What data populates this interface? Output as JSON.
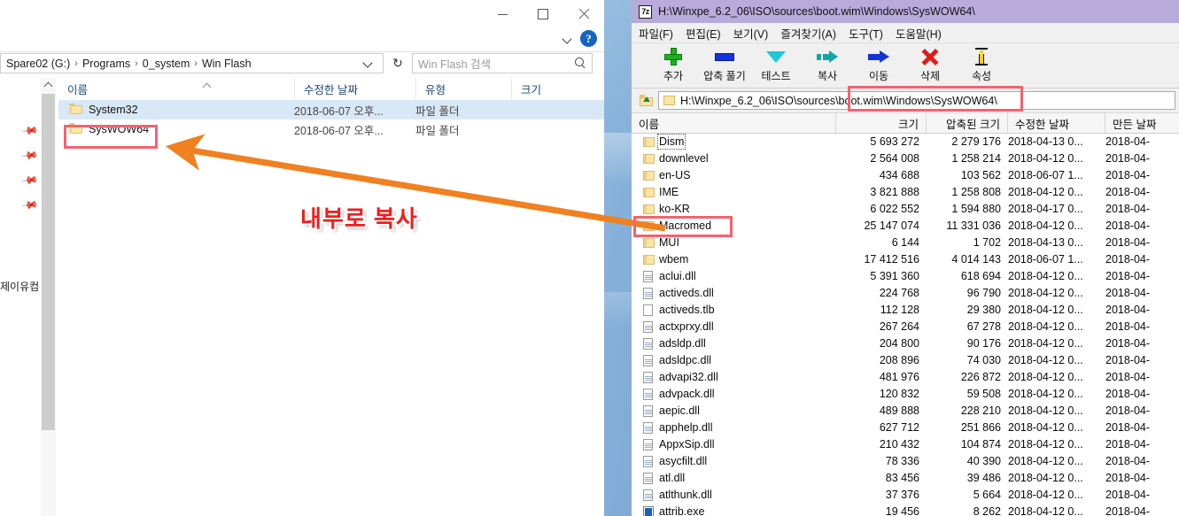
{
  "explorer": {
    "window_controls": {
      "minimize": "minimize-icon",
      "maximize": "maximize-icon",
      "close": "close-icon"
    },
    "ribbon": {
      "expand": "chevron-down-icon",
      "help": "?"
    },
    "breadcrumb": [
      "Spare02 (G:)",
      "Programs",
      "0_system",
      "Win Flash"
    ],
    "breadcrumb_separator": "›",
    "refresh_label": "↻",
    "search": {
      "placeholder": "Win Flash 검색",
      "icon": "search-icon"
    },
    "columns": [
      "이름",
      "수정한 날짜",
      "유형",
      "크기"
    ],
    "nav_label": "제이유컴",
    "rows": [
      {
        "name": "System32",
        "date": "2018-06-07 오후...",
        "type": "파일 폴더",
        "size": "",
        "selected": true
      },
      {
        "name": "SysWOW64",
        "date": "2018-06-07 오후...",
        "type": "파일 폴더",
        "size": "",
        "selected": false
      }
    ]
  },
  "sevenzip": {
    "title": "H:\\Winxpe_6.2_06\\ISO\\sources\\boot.wim\\Windows\\SysWOW64\\",
    "title_icon": "7z",
    "menu": [
      "파일(F)",
      "편집(E)",
      "보기(V)",
      "즐겨찾기(A)",
      "도구(T)",
      "도움말(H)"
    ],
    "toolbar": [
      {
        "label": "추가",
        "icon": "plus-icon"
      },
      {
        "label": "압축 풀기",
        "icon": "extract-icon"
      },
      {
        "label": "테스트",
        "icon": "test-chevron-icon"
      },
      {
        "label": "복사",
        "icon": "copy-arrow-icon"
      },
      {
        "label": "이동",
        "icon": "move-arrow-icon"
      },
      {
        "label": "삭제",
        "icon": "delete-x-icon"
      },
      {
        "label": "속성",
        "icon": "info-icon"
      }
    ],
    "up_icon": "up-folder-icon",
    "path": "H:\\Winxpe_6.2_06\\ISO\\sources\\boot.wim\\Windows\\SysWOW64\\",
    "columns": [
      "이름",
      "크기",
      "압축된 크기",
      "수정한 날짜",
      "만든 날짜"
    ],
    "rows": [
      {
        "name": "Dism",
        "size": "5 693 272",
        "packed": "2 279 176",
        "modified": "2018-04-13 0...",
        "created": "2018-04-",
        "kind": "folder",
        "focus": true
      },
      {
        "name": "downlevel",
        "size": "2 564 008",
        "packed": "1 258 214",
        "modified": "2018-04-12 0...",
        "created": "2018-04-",
        "kind": "folder"
      },
      {
        "name": "en-US",
        "size": "434 688",
        "packed": "103 562",
        "modified": "2018-06-07 1...",
        "created": "2018-04-",
        "kind": "folder"
      },
      {
        "name": "IME",
        "size": "3 821 888",
        "packed": "1 258 808",
        "modified": "2018-04-12 0...",
        "created": "2018-04-",
        "kind": "folder"
      },
      {
        "name": "ko-KR",
        "size": "6 022 552",
        "packed": "1 594 880",
        "modified": "2018-04-17 0...",
        "created": "2018-04-",
        "kind": "folder"
      },
      {
        "name": "Macromed",
        "size": "25 147 074",
        "packed": "11 331 036",
        "modified": "2018-04-12 0...",
        "created": "2018-04-",
        "kind": "folder"
      },
      {
        "name": "MUI",
        "size": "6 144",
        "packed": "1 702",
        "modified": "2018-04-13 0...",
        "created": "2018-04-",
        "kind": "folder"
      },
      {
        "name": "wbem",
        "size": "17 412 516",
        "packed": "4 014 143",
        "modified": "2018-06-07 1...",
        "created": "2018-04-",
        "kind": "folder"
      },
      {
        "name": "aclui.dll",
        "size": "5 391 360",
        "packed": "618 694",
        "modified": "2018-04-12 0...",
        "created": "2018-04-",
        "kind": "dll"
      },
      {
        "name": "activeds.dll",
        "size": "224 768",
        "packed": "96 790",
        "modified": "2018-04-12 0...",
        "created": "2018-04-",
        "kind": "dll"
      },
      {
        "name": "activeds.tlb",
        "size": "112 128",
        "packed": "29 380",
        "modified": "2018-04-12 0...",
        "created": "2018-04-",
        "kind": "doc"
      },
      {
        "name": "actxprxy.dll",
        "size": "267 264",
        "packed": "67 278",
        "modified": "2018-04-12 0...",
        "created": "2018-04-",
        "kind": "dll"
      },
      {
        "name": "adsldp.dll",
        "size": "204 800",
        "packed": "90 176",
        "modified": "2018-04-12 0...",
        "created": "2018-04-",
        "kind": "dll"
      },
      {
        "name": "adsldpc.dll",
        "size": "208 896",
        "packed": "74 030",
        "modified": "2018-04-12 0...",
        "created": "2018-04-",
        "kind": "dll"
      },
      {
        "name": "advapi32.dll",
        "size": "481 976",
        "packed": "226 872",
        "modified": "2018-04-12 0...",
        "created": "2018-04-",
        "kind": "dll"
      },
      {
        "name": "advpack.dll",
        "size": "120 832",
        "packed": "59 508",
        "modified": "2018-04-12 0...",
        "created": "2018-04-",
        "kind": "dll"
      },
      {
        "name": "aepic.dll",
        "size": "489 888",
        "packed": "228 210",
        "modified": "2018-04-12 0...",
        "created": "2018-04-",
        "kind": "dll"
      },
      {
        "name": "apphelp.dll",
        "size": "627 712",
        "packed": "251 866",
        "modified": "2018-04-12 0...",
        "created": "2018-04-",
        "kind": "dll"
      },
      {
        "name": "AppxSip.dll",
        "size": "210 432",
        "packed": "104 874",
        "modified": "2018-04-12 0...",
        "created": "2018-04-",
        "kind": "dll"
      },
      {
        "name": "asycfilt.dll",
        "size": "78 336",
        "packed": "40 390",
        "modified": "2018-04-12 0...",
        "created": "2018-04-",
        "kind": "dll"
      },
      {
        "name": "atl.dll",
        "size": "83 456",
        "packed": "39 486",
        "modified": "2018-04-12 0...",
        "created": "2018-04-",
        "kind": "dll"
      },
      {
        "name": "atlthunk.dll",
        "size": "37 376",
        "packed": "5 664",
        "modified": "2018-04-12 0...",
        "created": "2018-04-",
        "kind": "dll"
      },
      {
        "name": "attrib.exe",
        "size": "19 456",
        "packed": "8 262",
        "modified": "2018-04-12 0...",
        "created": "2018-04-",
        "kind": "exe"
      }
    ]
  },
  "annotation": {
    "text": "내부로 복사",
    "text_color": "#f41b1b",
    "arrow_color": "#f08020",
    "box_color": "#f4636e"
  }
}
